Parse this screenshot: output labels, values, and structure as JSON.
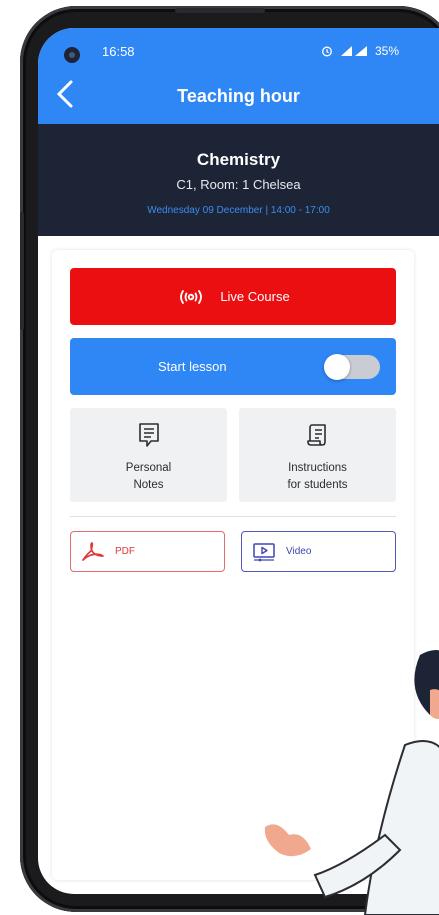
{
  "status_bar": {
    "time": "16:58",
    "battery": "35%",
    "icons": [
      "alarm-icon",
      "signal-icon",
      "battery-icon"
    ]
  },
  "header": {
    "title": "Teaching hour",
    "back_icon": "chevron-left-icon"
  },
  "lesson": {
    "subject": "Chemistry",
    "room": "C1, Room: 1 Chelsea",
    "schedule": "Wednesday 09 December | 14:00 - 17:00"
  },
  "actions": {
    "live_course_label": "Live Course",
    "start_lesson_label": "Start lesson",
    "start_lesson_on": false
  },
  "tiles": [
    {
      "label_line1": "Personal",
      "label_line2": "Notes",
      "icon": "notes-icon"
    },
    {
      "label_line1": "Instructions",
      "label_line2": "for students",
      "icon": "scroll-icon"
    }
  ],
  "documents": [
    {
      "label": "PDF",
      "icon": "pdf-icon"
    },
    {
      "label": "Video",
      "icon": "video-icon"
    }
  ],
  "colors": {
    "primary": "#2f86f5",
    "dark": "#1d2436",
    "live": "#ec0f12",
    "pdf": "#e2373a",
    "video": "#3f46b4"
  }
}
